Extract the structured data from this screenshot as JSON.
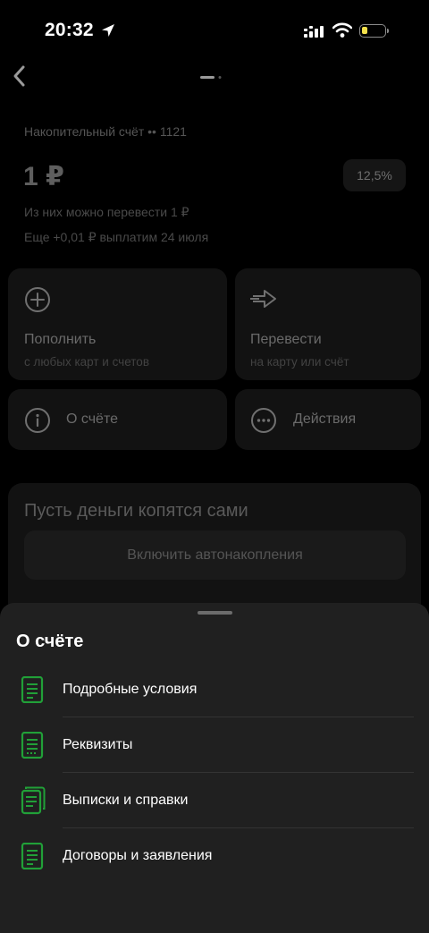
{
  "status_bar": {
    "time": "20:32"
  },
  "header": {
    "back_icon": "chevron-left-icon"
  },
  "account": {
    "label": "Накопительный счёт •• 1121",
    "balance": "1 ₽",
    "rate": "12,5%",
    "transferable": "Из них можно перевести 1 ₽",
    "payout_note": "Еще +0,01 ₽ выплатим 24 июля"
  },
  "actions": {
    "topup": {
      "title": "Пополнить",
      "subtitle": "с любых карт и счетов",
      "icon": "plus-circle-icon"
    },
    "transfer": {
      "title": "Перевести",
      "subtitle": "на карту или счёт",
      "icon": "arrow-right-icon"
    },
    "about": {
      "title": "О счёте",
      "icon": "info-icon"
    },
    "more": {
      "title": "Действия",
      "icon": "more-icon"
    }
  },
  "autosave": {
    "title": "Пусть деньги копятся сами",
    "button": "Включить автонакопления"
  },
  "sheet": {
    "title": "О счёте",
    "items": [
      {
        "label": "Подробные условия",
        "icon": "document-icon"
      },
      {
        "label": "Реквизиты",
        "icon": "document-details-icon"
      },
      {
        "label": "Выписки и справки",
        "icon": "documents-stack-icon"
      },
      {
        "label": "Договоры и заявления",
        "icon": "document-icon"
      }
    ]
  },
  "colors": {
    "accent_green": "#21a038",
    "sheet_bg": "#202020",
    "battery": "#f3e04b"
  }
}
